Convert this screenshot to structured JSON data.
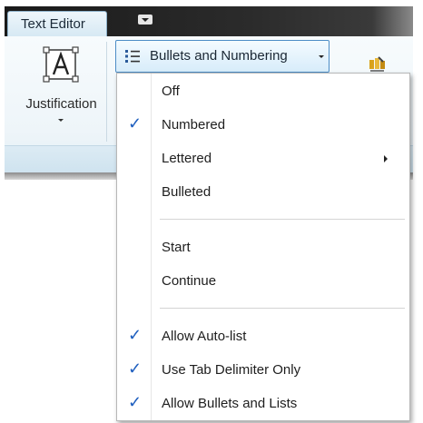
{
  "ribbon": {
    "active_tab": "Text Editor",
    "justification_label": "Justification",
    "bullets_button_label": "Bullets and Numbering"
  },
  "menu": {
    "groups": [
      [
        {
          "label": "Off",
          "checked": false,
          "submenu": false
        },
        {
          "label": "Numbered",
          "checked": true,
          "submenu": false
        },
        {
          "label": "Lettered",
          "checked": false,
          "submenu": true
        },
        {
          "label": "Bulleted",
          "checked": false,
          "submenu": false
        }
      ],
      [
        {
          "label": "Start",
          "checked": false,
          "submenu": false
        },
        {
          "label": "Continue",
          "checked": false,
          "submenu": false
        }
      ],
      [
        {
          "label": "Allow Auto-list",
          "checked": true,
          "submenu": false
        },
        {
          "label": "Use Tab Delimiter Only",
          "checked": true,
          "submenu": false
        },
        {
          "label": "Allow Bullets and Lists",
          "checked": true,
          "submenu": false
        }
      ]
    ],
    "check_glyph": "✓",
    "check_color": "#1f5fbf"
  },
  "icons": {
    "justification": "justification-icon",
    "bullets": "bulleted-list-icon",
    "quick_access_dropdown": "chevron-down-icon",
    "right_tool": "paint-icon"
  }
}
